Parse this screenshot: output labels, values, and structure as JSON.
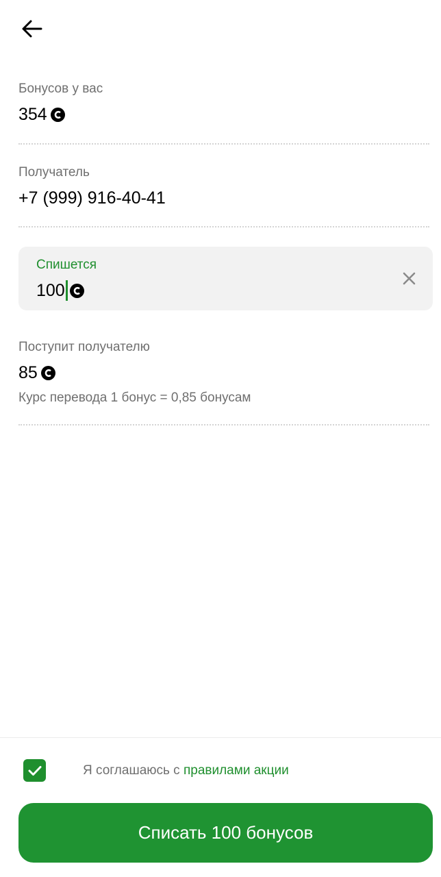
{
  "header": {
    "back_icon": "arrow-left-icon"
  },
  "balance": {
    "label": "Бонусов у вас",
    "value": "354",
    "icon": "bonus-coin-icon"
  },
  "recipient": {
    "label": "Получатель",
    "value": "+7 (999) 916-40-41"
  },
  "debit": {
    "label": "Спишется",
    "value": "100",
    "icon": "bonus-coin-icon",
    "clear_icon": "close-icon"
  },
  "receive": {
    "label": "Поступит получателю",
    "value": "85",
    "icon": "bonus-coin-icon",
    "rate_text": "Курс перевода 1 бонус = 0,85 бонусам"
  },
  "agreement": {
    "checked": true,
    "text": "Я соглашаюсь с ",
    "link_text": "правилами акции"
  },
  "submit": {
    "label": "Списать 100 бонусов"
  },
  "colors": {
    "accent": "#1f8f2e",
    "button": "#1f9332",
    "muted_text": "#6f6f6f",
    "input_bg": "#f2f2f2"
  }
}
